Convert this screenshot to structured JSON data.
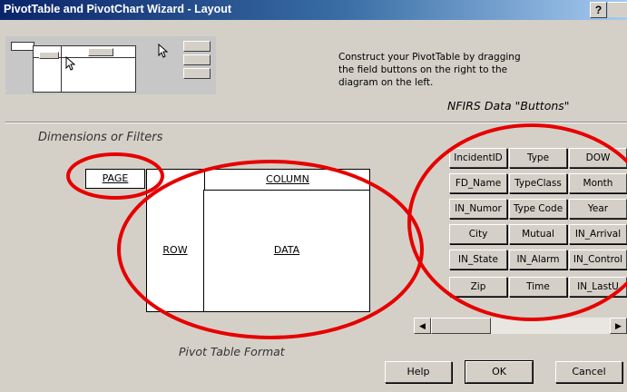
{
  "window": {
    "title": "PivotTable and PivotChart Wizard - Layout",
    "help_glyph": "?"
  },
  "instructions": [
    "Construct your PivotTable by dragging",
    "the field buttons on the right to the",
    "diagram on the left."
  ],
  "annotations": {
    "data_buttons_caption": "NFIRS Data \"Buttons\"",
    "dimensions_caption": "Dimensions or Filters",
    "format_caption": "Pivot Table Format",
    "ring_color": "#e60000"
  },
  "layout_areas": {
    "page": "PAGE",
    "column": "COLUMN",
    "row": "ROW",
    "data": "DATA"
  },
  "field_columns": [
    [
      "IncidentID",
      "FD_Name",
      "IN_Numor",
      "City",
      "IN_State",
      "Zip"
    ],
    [
      "Type",
      "TypeClass",
      "Type Code",
      "Mutual",
      "IN_Alarm",
      "Time"
    ],
    [
      "DOW",
      "Month",
      "Year",
      "IN_Arrival",
      "IN_Control",
      "IN_LastU"
    ]
  ],
  "scrollbar": {
    "left_icon": "arrow-left-icon",
    "right_icon": "arrow-right-icon"
  },
  "buttons": {
    "help": "Help",
    "ok": "OK",
    "cancel": "Cancel"
  }
}
